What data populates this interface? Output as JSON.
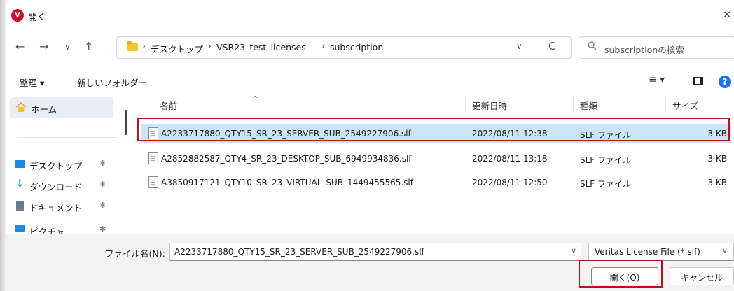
{
  "window": {
    "title": "開く",
    "app_icon": "veritas-icon",
    "close_symbol": "×"
  },
  "nav": {
    "back": "←",
    "forward": "→",
    "recent": "∨",
    "up": "↑",
    "breadcrumbs": [
      "デスクトップ",
      "VSR23_test_licenses",
      "subscription"
    ],
    "separator": "›",
    "dropdown": "∨",
    "refresh": "C",
    "search_placeholder": "subscriptionの検索",
    "search_symbol": "🔍"
  },
  "commands": {
    "organize": "整理 ▾",
    "new_folder": "新しいフォルダー",
    "view_menu": "≡ ▾"
  },
  "sidebar": {
    "home": "ホーム",
    "items": [
      {
        "label": "デスクトップ",
        "icon": "desktop-icon",
        "color": "#1e88e5"
      },
      {
        "label": "ダウンロード",
        "icon": "download-icon",
        "color": "#1e88e5"
      },
      {
        "label": "ドキュメント",
        "icon": "document-icon",
        "color": "#6b7a8f"
      },
      {
        "label": "ピクチャ",
        "icon": "picture-icon",
        "color": "#1e88e5"
      }
    ],
    "pin_symbol": "✱"
  },
  "columns": {
    "name": "名前",
    "modified": "更新日時",
    "type": "種類",
    "size": "サイズ"
  },
  "files": [
    {
      "name": "A2233717880_QTY15_SR_23_SERVER_SUB_2549227906.slf",
      "modified": "2022/08/11 12:38",
      "type": "SLF ファイル",
      "size": "3 KB",
      "selected": true
    },
    {
      "name": "A2852882587_QTY4_SR_23_DESKTOP_SUB_6949934836.slf",
      "modified": "2022/08/11 13:18",
      "type": "SLF ファイル",
      "size": "3 KB",
      "selected": false
    },
    {
      "name": "A3850917121_QTY10_SR_23_VIRTUAL_SUB_1449455565.slf",
      "modified": "2022/08/11 12:50",
      "type": "SLF ファイル",
      "size": "3 KB",
      "selected": false
    }
  ],
  "bottom": {
    "filename_label": "ファイル名(N):",
    "filename_value": "A2233717880_QTY15_SR_23_SERVER_SUB_2549227906.slf",
    "filetype_value": "Veritas License File (*.slf)",
    "open_label": "開く(O)",
    "cancel_label": "キャンセル",
    "dropdown": "∨"
  },
  "colors": {
    "accent": "#c8102e",
    "highlight_outline": "#b4141c",
    "selection": "#cce4f7"
  }
}
